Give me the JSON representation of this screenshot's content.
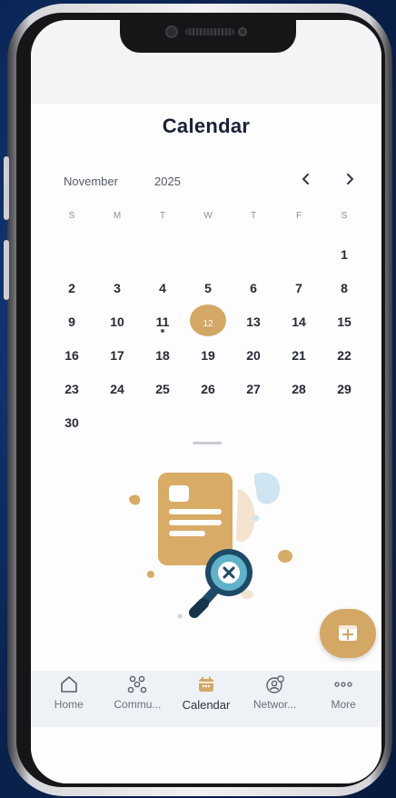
{
  "header": {
    "title": "Calendar"
  },
  "calendar": {
    "month": "November",
    "year": "2025",
    "prev_icon": "chevron-left-icon",
    "next_icon": "chevron-right-icon",
    "weekdays": [
      "S",
      "M",
      "T",
      "W",
      "T",
      "F",
      "S"
    ],
    "days": [
      "1",
      "2",
      "3",
      "4",
      "5",
      "6",
      "7",
      "8",
      "9",
      "10",
      "11",
      "12",
      "13",
      "14",
      "15",
      "16",
      "17",
      "18",
      "19",
      "20",
      "21",
      "22",
      "23",
      "24",
      "25",
      "26",
      "27",
      "28",
      "29",
      "30"
    ],
    "leading_blanks": 6,
    "selected_day": "12",
    "event_day": "11",
    "accent_color": "#d3a865"
  },
  "empty_state": {
    "icon": "no-document-search-icon"
  },
  "fab": {
    "icon": "add-event-icon"
  },
  "bottom_nav": {
    "items": [
      {
        "label": "Home",
        "icon": "home-icon"
      },
      {
        "label": "Commu...",
        "icon": "community-icon"
      },
      {
        "label": "Calendar",
        "icon": "calendar-icon",
        "active": true
      },
      {
        "label": "Networ...",
        "icon": "network-icon"
      },
      {
        "label": "More",
        "icon": "more-dots-icon"
      }
    ]
  }
}
